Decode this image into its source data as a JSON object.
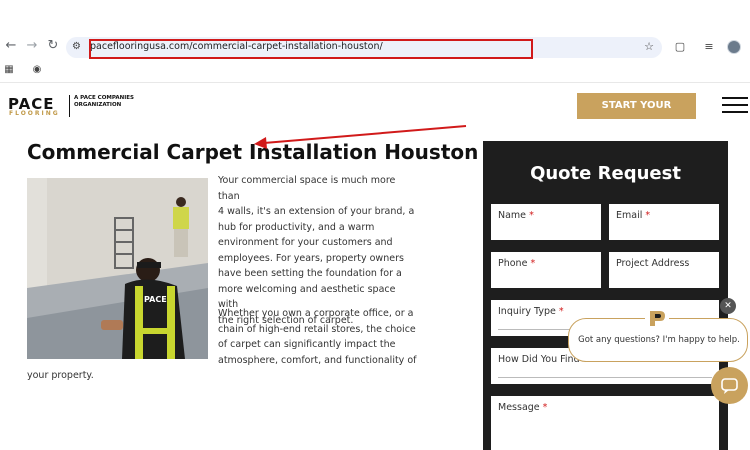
{
  "browser": {
    "url": "paceflooringusa.com/commercial-carpet-installation-houston/",
    "back_icon": "arrow-left-icon",
    "forward_icon": "arrow-right-icon",
    "reload_icon": "reload-icon"
  },
  "site": {
    "logo_text": "PACE",
    "logo_sub": "FLOORING",
    "tagline": "A PACE COMPANIES ORGANIZATION",
    "cta_label": "START YOUR PROJECT",
    "brand_color": "#c9a25e"
  },
  "main": {
    "title": "Commercial Carpet Installation Houston",
    "paragraph1": [
      "Your commercial space is much more than",
      "4 walls, it's an extension of your brand, a",
      "hub for productivity,  and a warm",
      "environment for your customers and",
      "employees. For years, property owners",
      "have been setting the foundation for a",
      "more welcoming and aesthetic space with",
      "the right selection of carpet."
    ],
    "paragraph2": [
      "Whether you own a corporate office, or a",
      "chain of high-end retail stores, the choice",
      "of carpet can significantly impact the",
      "atmosphere, comfort, and functionality of"
    ],
    "paragraph2_last": "your property.",
    "vest_text": "PACE"
  },
  "quote": {
    "title": "Quote Request",
    "fields": {
      "name": "Name",
      "email": "Email",
      "phone": "Phone",
      "project_address": "Project Address",
      "inquiry_type": "Inquiry Type",
      "how_did_you_find": "How Did You Find Us?",
      "message": "Message"
    },
    "required_mark": "*"
  },
  "chat": {
    "message": "Got any questions? I'm happy to help.",
    "close": "✕"
  }
}
